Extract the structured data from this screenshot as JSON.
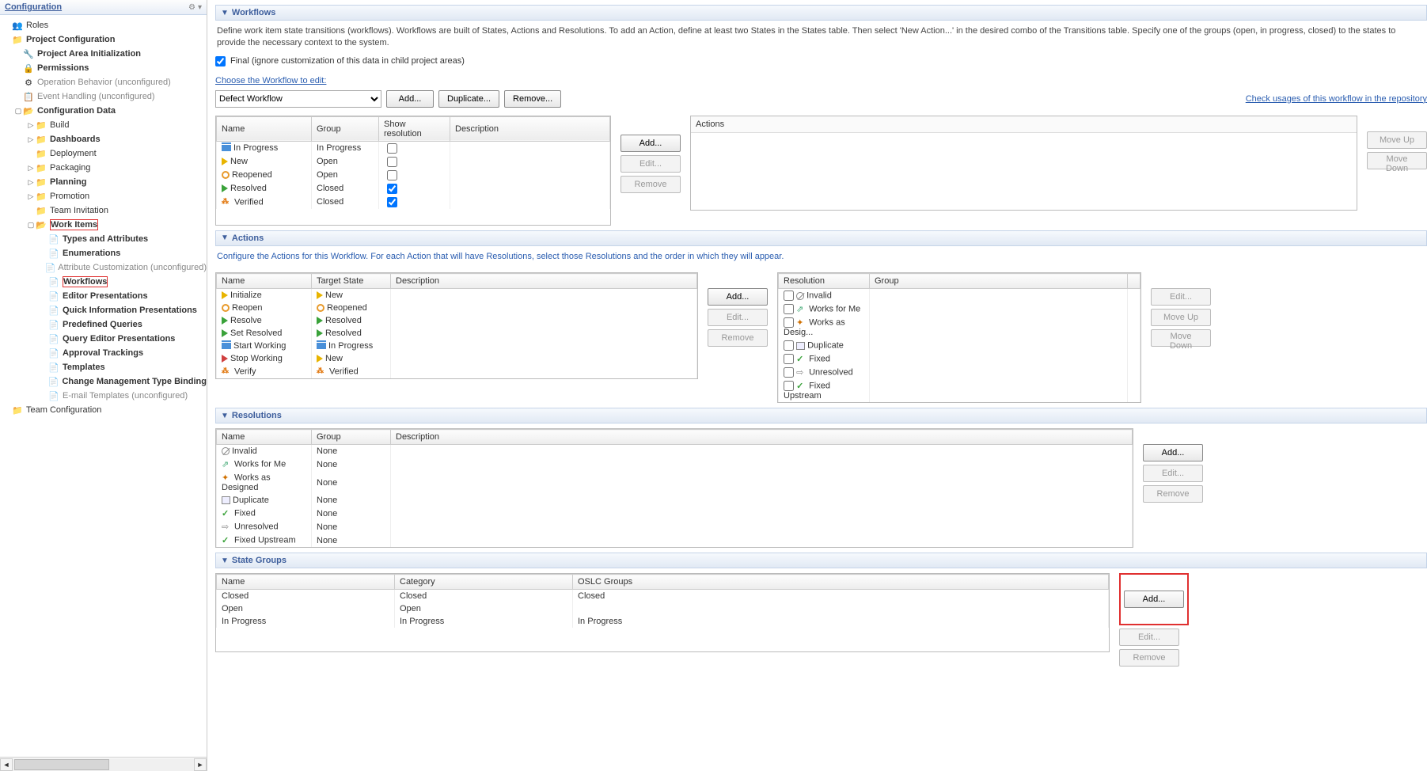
{
  "sidebar": {
    "title": "Configuration",
    "items": [
      {
        "lvl": 0,
        "tw": "",
        "icon": "👥",
        "label": "Roles",
        "bold": false
      },
      {
        "lvl": 0,
        "tw": "",
        "icon": "📁",
        "label": "Project Configuration",
        "bold": true
      },
      {
        "lvl": 1,
        "tw": "",
        "icon": "🔧",
        "label": "Project Area Initialization",
        "bold": true
      },
      {
        "lvl": 1,
        "tw": "",
        "icon": "🔒",
        "label": "Permissions",
        "bold": true
      },
      {
        "lvl": 1,
        "tw": "",
        "icon": "⚙",
        "label": "Operation Behavior (unconfigured)",
        "bold": false,
        "unconf": true
      },
      {
        "lvl": 1,
        "tw": "",
        "icon": "📋",
        "label": "Event Handling (unconfigured)",
        "bold": false,
        "unconf": true
      },
      {
        "lvl": 1,
        "tw": "▢",
        "icon": "📂",
        "label": "Configuration Data",
        "bold": true
      },
      {
        "lvl": 2,
        "tw": "▷",
        "icon": "📁",
        "label": "Build",
        "bold": false
      },
      {
        "lvl": 2,
        "tw": "▷",
        "icon": "📁",
        "label": "Dashboards",
        "bold": true
      },
      {
        "lvl": 2,
        "tw": "",
        "icon": "📁",
        "label": "Deployment",
        "bold": false
      },
      {
        "lvl": 2,
        "tw": "▷",
        "icon": "📁",
        "label": "Packaging",
        "bold": false
      },
      {
        "lvl": 2,
        "tw": "▷",
        "icon": "📁",
        "label": "Planning",
        "bold": true
      },
      {
        "lvl": 2,
        "tw": "▷",
        "icon": "📁",
        "label": "Promotion",
        "bold": false
      },
      {
        "lvl": 2,
        "tw": "",
        "icon": "📁",
        "label": "Team Invitation",
        "bold": false
      },
      {
        "lvl": 2,
        "tw": "▢",
        "icon": "📂",
        "label": "Work Items",
        "bold": true,
        "red": true
      },
      {
        "lvl": 3,
        "tw": "",
        "icon": "📄",
        "label": "Types and Attributes",
        "bold": true
      },
      {
        "lvl": 3,
        "tw": "",
        "icon": "📄",
        "label": "Enumerations",
        "bold": true
      },
      {
        "lvl": 3,
        "tw": "",
        "icon": "📄",
        "label": "Attribute Customization (unconfigured)",
        "bold": false,
        "unconf": true
      },
      {
        "lvl": 3,
        "tw": "",
        "icon": "📄",
        "label": "Workflows",
        "bold": true,
        "red": true
      },
      {
        "lvl": 3,
        "tw": "",
        "icon": "📄",
        "label": "Editor Presentations",
        "bold": true
      },
      {
        "lvl": 3,
        "tw": "",
        "icon": "📄",
        "label": "Quick Information Presentations",
        "bold": true
      },
      {
        "lvl": 3,
        "tw": "",
        "icon": "📄",
        "label": "Predefined Queries",
        "bold": true
      },
      {
        "lvl": 3,
        "tw": "",
        "icon": "📄",
        "label": "Query Editor Presentations",
        "bold": true
      },
      {
        "lvl": 3,
        "tw": "",
        "icon": "📄",
        "label": "Approval Trackings",
        "bold": true
      },
      {
        "lvl": 3,
        "tw": "",
        "icon": "📄",
        "label": "Templates",
        "bold": true
      },
      {
        "lvl": 3,
        "tw": "",
        "icon": "📄",
        "label": "Change Management Type Binding",
        "bold": true
      },
      {
        "lvl": 3,
        "tw": "",
        "icon": "📄",
        "label": "E-mail Templates (unconfigured)",
        "bold": false,
        "unconf": true
      },
      {
        "lvl": 0,
        "tw": "",
        "icon": "📁",
        "label": "Team Configuration",
        "bold": false
      }
    ]
  },
  "workflows": {
    "header": "Workflows",
    "desc": "Define work item state transitions (workflows). Workflows are built of States, Actions and Resolutions. To add an Action, define at least two States in the States table. Then select 'New Action...' in the desired combo of the Transitions table. Specify one of the groups (open, in progress, closed) to the states to provide the necessary context to the system.",
    "final_label": "Final (ignore customization of this data in child project areas)",
    "choose_label": "Choose the Workflow to edit:",
    "workflow_name": "Defect Workflow",
    "add": "Add...",
    "dup": "Duplicate...",
    "rem": "Remove...",
    "check_link": "Check usages of this workflow in the repository",
    "states_cols": [
      "Name",
      "Group",
      "Show resolution",
      "Description"
    ],
    "states": [
      {
        "ico": "bars",
        "name": "In Progress",
        "group": "In Progress",
        "res": false
      },
      {
        "ico": "arrow-y",
        "name": "New",
        "group": "Open",
        "res": false
      },
      {
        "ico": "circle-o",
        "name": "Reopened",
        "group": "Open",
        "res": false
      },
      {
        "ico": "arrow-g",
        "name": "Resolved",
        "group": "Closed",
        "res": true
      },
      {
        "ico": "dots",
        "name": "Verified",
        "group": "Closed",
        "res": true
      }
    ],
    "btns": {
      "add": "Add...",
      "edit": "Edit...",
      "remove": "Remove",
      "moveup": "Move Up",
      "movedown": "Move Down"
    },
    "actions_panel": "Actions"
  },
  "actions": {
    "header": "Actions",
    "desc": "Configure the Actions for this Workflow.  For each Action that will have Resolutions, select those Resolutions and the order in which they will appear.",
    "cols": [
      "Name",
      "Target State",
      "Description"
    ],
    "rows": [
      {
        "ico": "arrow-y",
        "name": "Initialize",
        "tico": "arrow-y",
        "target": "New"
      },
      {
        "ico": "circle-o",
        "name": "Reopen",
        "tico": "circle-o",
        "target": "Reopened"
      },
      {
        "ico": "arrow-g",
        "name": "Resolve",
        "tico": "arrow-g",
        "target": "Resolved"
      },
      {
        "ico": "arrow-g",
        "name": "Set Resolved",
        "tico": "arrow-g",
        "target": "Resolved"
      },
      {
        "ico": "bars",
        "name": "Start Working",
        "tico": "bars",
        "target": "In Progress"
      },
      {
        "ico": "arrow-r",
        "name": "Stop Working",
        "tico": "arrow-y",
        "target": "New"
      },
      {
        "ico": "dots",
        "name": "Verify",
        "tico": "dots",
        "target": "Verified"
      }
    ],
    "res_cols": [
      "Resolution",
      "Group"
    ],
    "res_rows": [
      {
        "ico": "null",
        "name": "Invalid"
      },
      {
        "ico": "send",
        "name": "Works for Me"
      },
      {
        "ico": "dia",
        "name": "Works as Desig..."
      },
      {
        "ico": "dup",
        "name": "Duplicate"
      },
      {
        "ico": "check",
        "name": "Fixed"
      },
      {
        "ico": "arrow-plain",
        "name": "Unresolved"
      },
      {
        "ico": "check",
        "name": "Fixed Upstream"
      }
    ],
    "btns": {
      "add": "Add...",
      "edit": "Edit...",
      "remove": "Remove",
      "moveup": "Move Up",
      "movedown": "Move Down"
    }
  },
  "resolutions": {
    "header": "Resolutions",
    "cols": [
      "Name",
      "Group",
      "Description"
    ],
    "rows": [
      {
        "ico": "null",
        "name": "Invalid",
        "group": "None"
      },
      {
        "ico": "send",
        "name": "Works for Me",
        "group": "None"
      },
      {
        "ico": "dia",
        "name": "Works as Designed",
        "group": "None"
      },
      {
        "ico": "dup",
        "name": "Duplicate",
        "group": "None"
      },
      {
        "ico": "check",
        "name": "Fixed",
        "group": "None"
      },
      {
        "ico": "arrow-plain",
        "name": "Unresolved",
        "group": "None"
      },
      {
        "ico": "check",
        "name": "Fixed Upstream",
        "group": "None"
      }
    ],
    "btns": {
      "add": "Add...",
      "edit": "Edit...",
      "remove": "Remove"
    }
  },
  "stategroups": {
    "header": "State Groups",
    "cols": [
      "Name",
      "Category",
      "OSLC Groups"
    ],
    "rows": [
      {
        "name": "Closed",
        "cat": "Closed",
        "oslc": "Closed"
      },
      {
        "name": "Open",
        "cat": "Open",
        "oslc": ""
      },
      {
        "name": "In Progress",
        "cat": "In Progress",
        "oslc": "In Progress"
      }
    ],
    "btns": {
      "add": "Add...",
      "edit": "Edit...",
      "remove": "Remove"
    }
  }
}
